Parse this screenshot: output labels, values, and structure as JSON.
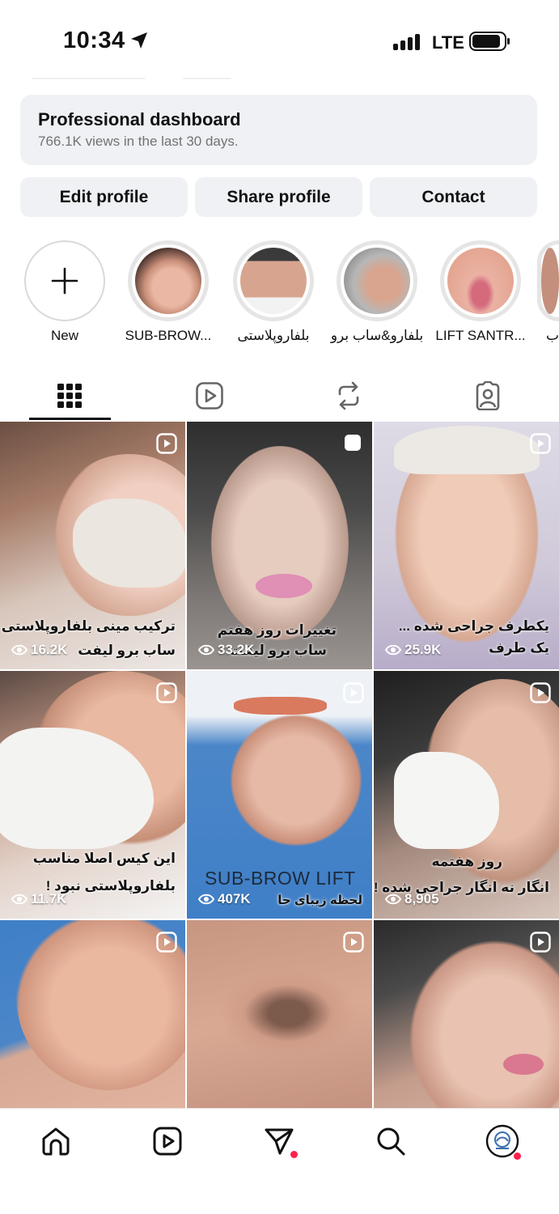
{
  "status_bar": {
    "time": "10:34",
    "network": "LTE"
  },
  "dashboard": {
    "title": "Professional dashboard",
    "subtitle": "766.1K views in the last 30 days."
  },
  "actions": {
    "edit": "Edit profile",
    "share": "Share profile",
    "contact": "Contact"
  },
  "highlights": [
    {
      "label": "New"
    },
    {
      "label": "SUB-BROW..."
    },
    {
      "label": "بلفاروپلاستی"
    },
    {
      "label": "بلفارو&ساب برو"
    },
    {
      "label": "LIFT SANTR..."
    },
    {
      "label": "ب"
    }
  ],
  "tabs": [
    {
      "name": "posts-grid-icon"
    },
    {
      "name": "reels-icon"
    },
    {
      "name": "reposts-icon"
    },
    {
      "name": "tagged-icon"
    }
  ],
  "posts": [
    {
      "caption1": "ترکیب مینی بلفاروپلاستی و",
      "caption2": "ساب برو لیفت",
      "views": "16.2K"
    },
    {
      "caption1": "تغییرات روز هفتم",
      "caption2": "ساب برو لیفت",
      "views": "33.2K"
    },
    {
      "caption1": "یکطرف جراحی شده ...",
      "caption2": "یک طرف",
      "views": "25.9K"
    },
    {
      "caption1": "این کیس اصلا مناسب",
      "caption2": "بلفاروپلاستی نبود !",
      "views": "11.7K"
    },
    {
      "overlay": "SUB-BROW LIFT",
      "caption2": "لحظه زیبای جا",
      "views": "407K"
    },
    {
      "caption1": "روز هفتمه",
      "caption2": "انگار نه انگار جراحی شده !",
      "views": "8,905"
    },
    {
      "caption1": "",
      "caption2": "",
      "views": ""
    },
    {
      "caption1": "",
      "caption2": "",
      "views": ""
    },
    {
      "caption1": "",
      "caption2": "",
      "views": ""
    }
  ],
  "colors": {
    "accent_dot": "#ff1f4b",
    "button_bg": "#eff1f4",
    "scrubs_blue": "#3f7fc7"
  }
}
